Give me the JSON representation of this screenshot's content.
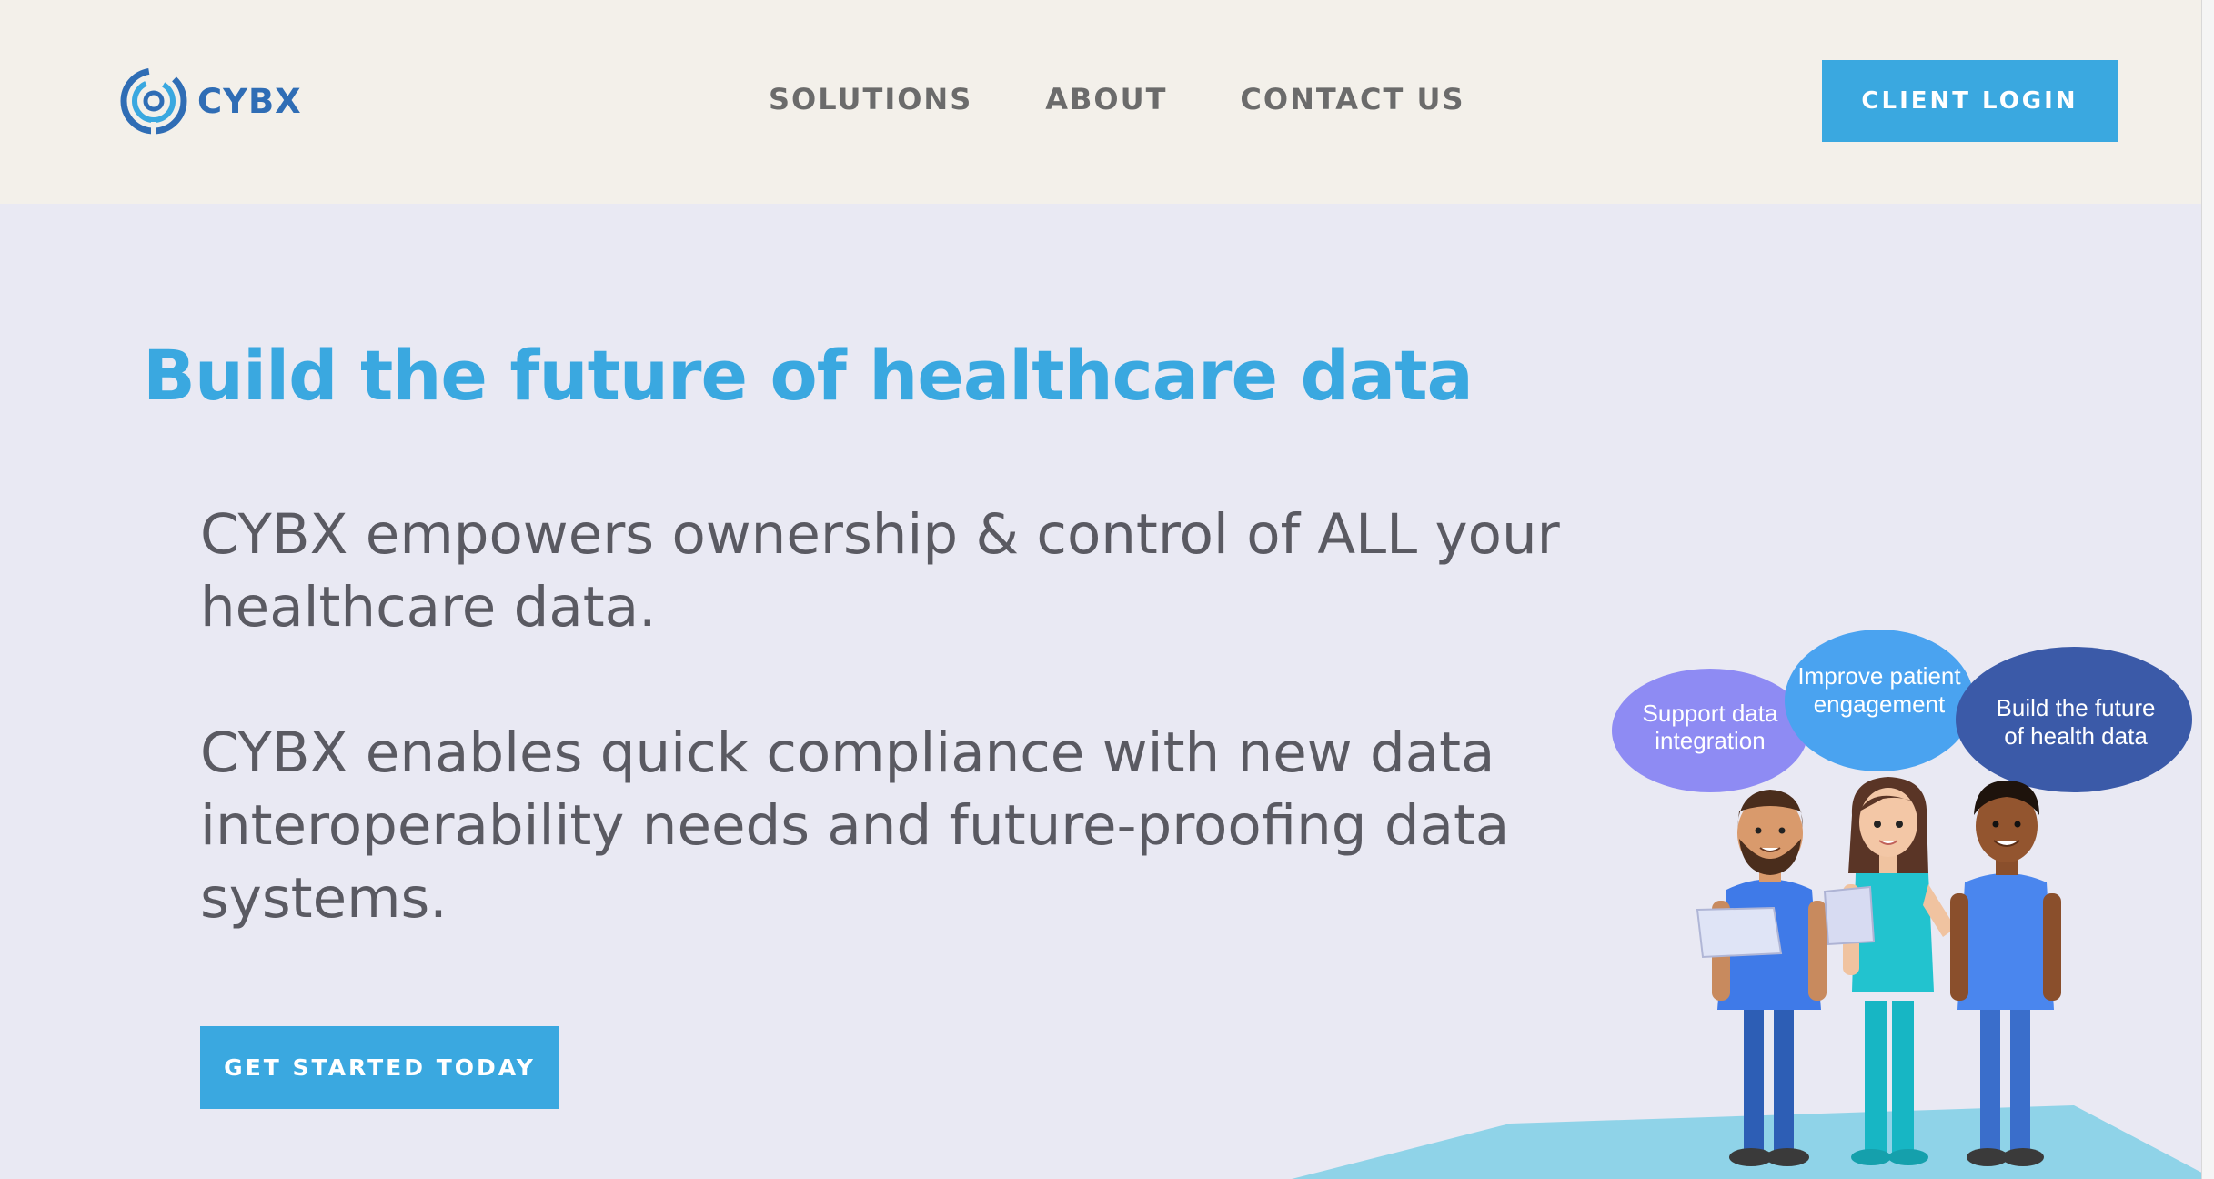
{
  "brand": {
    "name": "CYBX",
    "logo_icon": "cybx-logo-icon",
    "accent": "#3aa8e0",
    "logo_color": "#2f6db5"
  },
  "nav": {
    "items": [
      {
        "label": "SOLUTIONS"
      },
      {
        "label": "ABOUT"
      },
      {
        "label": "CONTACT US"
      }
    ],
    "login_label": "CLIENT LOGIN"
  },
  "hero": {
    "title": "Build the future of healthcare data",
    "paragraph1": "CYBX empowers ownership & control of ALL your healthcare data.",
    "paragraph2": "CYBX enables quick compliance with new data interoperability needs and future-proofing data systems.",
    "cta_label": "GET STARTED TODAY"
  },
  "illustration": {
    "bubbles": [
      {
        "line1": "Support data",
        "line2": "integration",
        "color": "#8e8bf3"
      },
      {
        "line1": "Improve patient",
        "line2": "engagement",
        "color": "#4aa3f0"
      },
      {
        "line1": "Build the future",
        "line2": "of health data",
        "color": "#3b5aa8"
      }
    ]
  }
}
